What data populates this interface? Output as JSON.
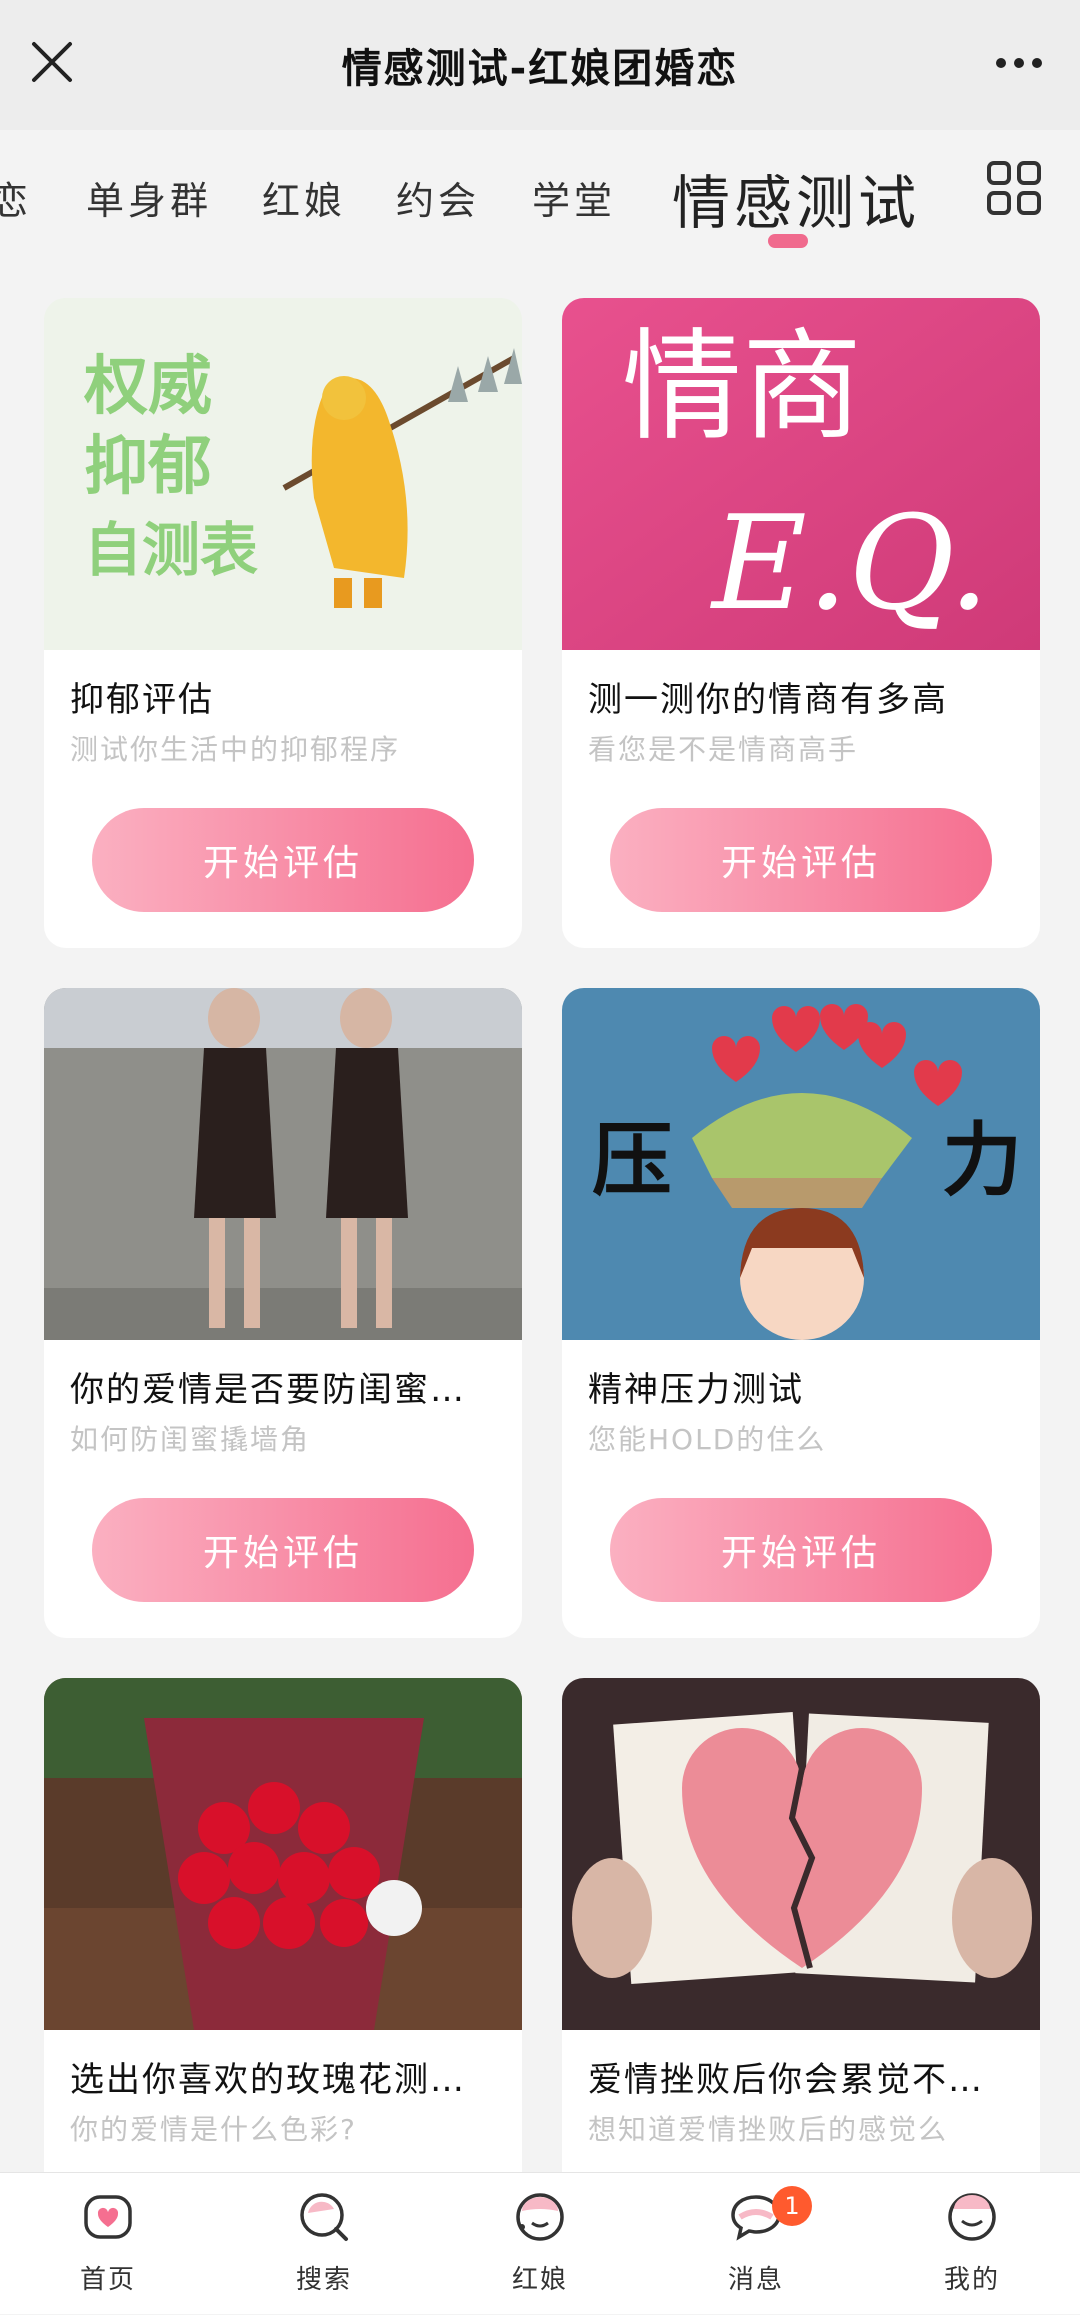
{
  "header": {
    "title": "情感测试-红娘团婚恋"
  },
  "tabs": {
    "partial": "恋",
    "items": [
      "单身群",
      "红娘",
      "约会",
      "学堂"
    ],
    "active": "情感测试"
  },
  "cards": [
    {
      "title": "抑郁评估",
      "subtitle": "测试你生活中的抑郁程序",
      "button": "开始评估",
      "image_text": [
        "权威",
        "抑郁",
        "自测表"
      ]
    },
    {
      "title": "测一测你的情商有多高",
      "subtitle": "看您是不是情商高手",
      "button": "开始评估",
      "image_text": [
        "情商",
        "E.Q."
      ]
    },
    {
      "title": "你的爱情是否要防闺蜜…",
      "subtitle": "如何防闺蜜撬墙角",
      "button": "开始评估"
    },
    {
      "title": "精神压力测试",
      "subtitle": "您能HOLD的住么",
      "button": "开始评估",
      "image_text": [
        "压",
        "力"
      ]
    },
    {
      "title": "选出你喜欢的玫瑰花测…",
      "subtitle": "你的爱情是什么色彩?"
    },
    {
      "title": "爱情挫败后你会累觉不…",
      "subtitle": "想知道爱情挫败后的感觉么"
    }
  ],
  "bottom_nav": {
    "items": [
      {
        "label": "首页",
        "icon": "home-icon"
      },
      {
        "label": "搜索",
        "icon": "search-icon"
      },
      {
        "label": "红娘",
        "icon": "matchmaker-icon"
      },
      {
        "label": "消息",
        "icon": "message-icon"
      },
      {
        "label": "我的",
        "icon": "profile-icon"
      }
    ],
    "badge": "1"
  },
  "colors": {
    "accent": "#f56f90",
    "accent_light": "#fbb0c1",
    "badge": "#ff5a2e"
  }
}
